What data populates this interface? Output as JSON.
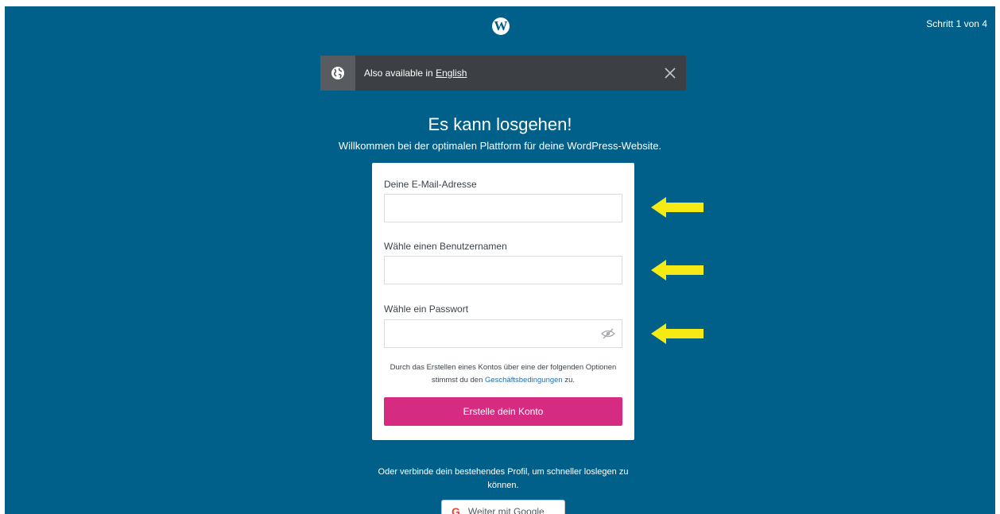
{
  "header": {
    "logo": "W",
    "step_indicator": "Schritt 1 von 4"
  },
  "language_banner": {
    "text": "Also available in",
    "link": "English"
  },
  "hero": {
    "title": "Es kann losgehen!",
    "subtitle": "Willkommen bei der optimalen Plattform für deine WordPress-Website."
  },
  "form": {
    "email_label": "Deine E-Mail-Adresse",
    "email_value": "",
    "username_label": "Wähle einen Benutzernamen",
    "username_value": "",
    "password_label": "Wähle ein Passwort",
    "password_value": "",
    "terms_text_1": "Durch das Erstellen eines Kontos über eine der folgenden Optionen stimmst du den",
    "terms_link": "Geschäftsbedingungen",
    "terms_text_2": "zu.",
    "submit_label": "Erstelle dein Konto"
  },
  "alternative": {
    "text": "Oder verbinde dein bestehendes Profil, um schneller loslegen zu können.",
    "google_label": "Weiter mit Google"
  },
  "colors": {
    "background": "#01608a",
    "banner": "#3c3f44",
    "primary_button": "#d52c82",
    "arrow": "#f5ea14",
    "link": "#2271b1"
  },
  "icons": [
    "wordpress-logo-icon",
    "globe-icon",
    "close-icon",
    "eye-slash-icon",
    "arrow-left-icon",
    "google-icon"
  ]
}
